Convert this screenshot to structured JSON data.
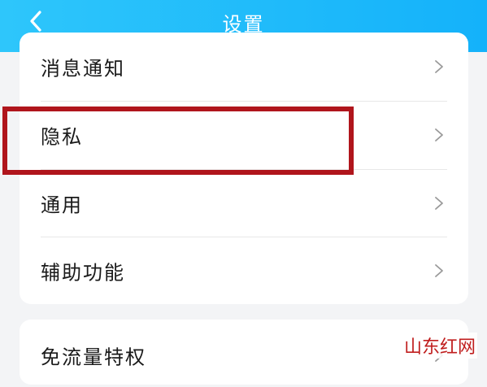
{
  "header": {
    "title": "设置",
    "back_icon": "chevron-left-icon"
  },
  "settings_group_1": {
    "items": [
      {
        "label": "消息通知",
        "icon": "chevron-right-icon"
      },
      {
        "label": "隐私",
        "icon": "chevron-right-icon"
      },
      {
        "label": "通用",
        "icon": "chevron-right-icon"
      },
      {
        "label": "辅助功能",
        "icon": "chevron-right-icon"
      }
    ]
  },
  "settings_group_2": {
    "items": [
      {
        "label": "免流量特权",
        "icon": "chevron-right-icon"
      }
    ]
  },
  "highlight": {
    "color": "#b0151c",
    "target": "隐私"
  },
  "watermark": {
    "text": "山东红网"
  },
  "colors": {
    "header_start": "#2ec6fb",
    "header_end": "#14b2fa",
    "background": "#f3f4f6"
  }
}
